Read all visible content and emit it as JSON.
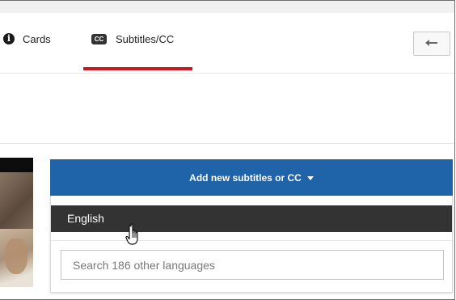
{
  "tabs": {
    "cards": {
      "label": "Cards",
      "icon": "info-icon"
    },
    "subtitles": {
      "label": "Subtitles/CC",
      "icon_text": "CC",
      "active": true
    }
  },
  "toolbar": {
    "back_icon": "back-arrow-icon"
  },
  "subtitles_menu": {
    "add_button_label": "Add new subtitles or CC",
    "options": [
      {
        "label": "English",
        "highlighted": true
      }
    ],
    "search_placeholder": "Search 186 other languages"
  },
  "colors": {
    "accent_blue": "#1f64a8",
    "active_tab_underline": "#cc181e",
    "highlight_row": "#333333"
  }
}
